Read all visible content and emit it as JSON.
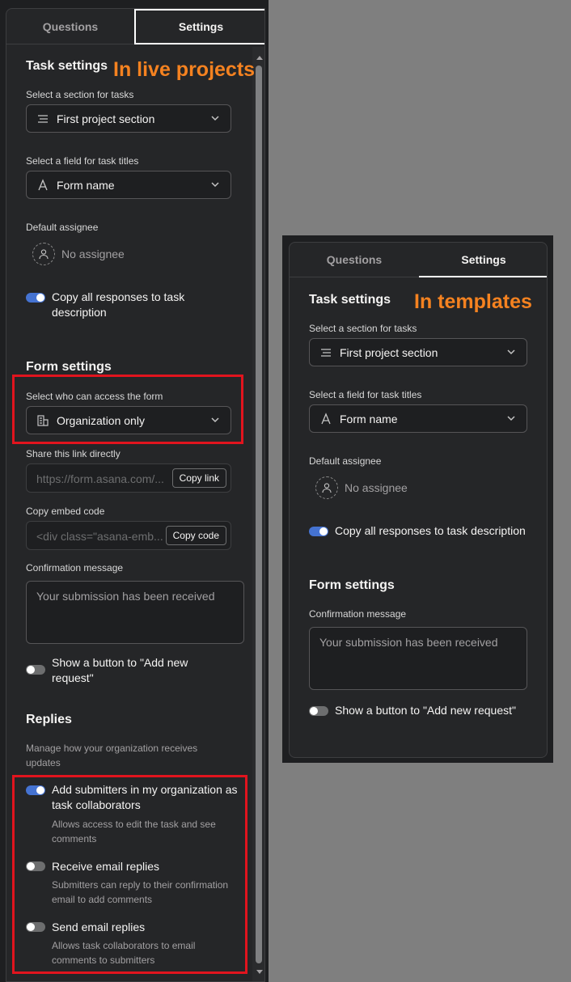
{
  "live": {
    "tabs": [
      "Questions",
      "Settings"
    ],
    "annotation": "In live projects",
    "task_settings": {
      "heading": "Task settings",
      "section_label": "Select a section for tasks",
      "section_value": "First project section",
      "title_label": "Select a field for task titles",
      "title_value": "Form name",
      "assignee_label": "Default assignee",
      "assignee_value": "No assignee",
      "copy_toggle_label": "Copy all responses to task description"
    },
    "form_settings": {
      "heading": "Form settings",
      "access_label": "Select who can access the form",
      "access_value": "Organization only",
      "share_label": "Share this link directly",
      "share_placeholder": "https://form.asana.com/...",
      "copy_link_button": "Copy link",
      "embed_label": "Copy embed code",
      "embed_placeholder": "<div class=\"asana-emb...",
      "copy_code_button": "Copy code",
      "confirmation_label": "Confirmation message",
      "confirmation_value": "Your submission has been received",
      "add_new_toggle_label": "Show a button to \"Add new request\""
    },
    "replies": {
      "heading": "Replies",
      "description": "Manage how your organization receives updates",
      "items": [
        {
          "label": "Add submitters in my organization as task collaborators",
          "desc": "Allows access to edit the task and see comments",
          "on": true
        },
        {
          "label": "Receive email replies",
          "desc": "Submitters can reply to their confirmation email to add comments",
          "on": false
        },
        {
          "label": "Send email replies",
          "desc": "Allows task collaborators to email comments to submitters",
          "on": false
        }
      ]
    }
  },
  "template": {
    "tabs": [
      "Questions",
      "Settings"
    ],
    "annotation": "In templates",
    "task_settings": {
      "heading": "Task settings",
      "section_label": "Select a section for tasks",
      "section_value": "First project section",
      "title_label": "Select a field for task titles",
      "title_value": "Form name",
      "assignee_label": "Default assignee",
      "assignee_value": "No assignee",
      "copy_toggle_label": "Copy all responses to task description"
    },
    "form_settings": {
      "heading": "Form settings",
      "confirmation_label": "Confirmation message",
      "confirmation_value": "Your submission has been received",
      "add_new_toggle_label": "Show a button to \"Add new request\""
    }
  },
  "colors": {
    "accent": "#4573d2",
    "highlight": "#e1141e",
    "annotation": "#f58220"
  }
}
